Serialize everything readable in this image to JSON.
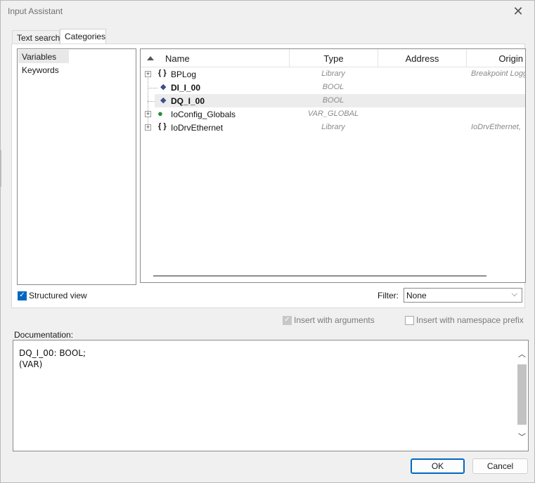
{
  "window": {
    "title": "Input Assistant"
  },
  "tabs": [
    {
      "label": "Text search",
      "active": false
    },
    {
      "label": "Categories",
      "active": true
    }
  ],
  "categories": [
    {
      "label": "Variables",
      "selected": true
    },
    {
      "label": "Keywords",
      "selected": false
    }
  ],
  "tree": {
    "columns": {
      "name": "Name",
      "type": "Type",
      "address": "Address",
      "origin": "Origin"
    },
    "rows": [
      {
        "name": "BPLog",
        "icon": "namespace-icon",
        "type": "Library",
        "origin": "Breakpoint Logg",
        "expandable": true
      },
      {
        "name": "DI_I_00",
        "icon": "variable-icon",
        "type": "BOOL",
        "origin": "",
        "expandable": false
      },
      {
        "name": "DQ_I_00",
        "icon": "variable-icon",
        "type": "BOOL",
        "origin": "",
        "expandable": false,
        "selected": true
      },
      {
        "name": "IoConfig_Globals",
        "icon": "globe-icon",
        "type": "VAR_GLOBAL",
        "origin": "",
        "expandable": true
      },
      {
        "name": "IoDrvEthernet",
        "icon": "namespace-icon",
        "type": "Library",
        "origin": "IoDrvEthernet,",
        "expandable": true
      }
    ]
  },
  "options": {
    "structured_view": "Structured view",
    "filter_label": "Filter:",
    "filter_value": "None",
    "insert_with_arguments": "Insert with arguments",
    "insert_with_namespace_prefix": "Insert with namespace prefix"
  },
  "documentation": {
    "label": "Documentation:",
    "line1": "DQ_I_00: BOOL;",
    "line2": "(VAR)"
  },
  "buttons": {
    "ok": "OK",
    "cancel": "Cancel"
  },
  "icons": {
    "close": "close-icon",
    "expand": "expand-plus-icon",
    "sort": "sort-ascending-icon"
  },
  "colors": {
    "accent": "#0067c0",
    "selection": "#ececec"
  }
}
